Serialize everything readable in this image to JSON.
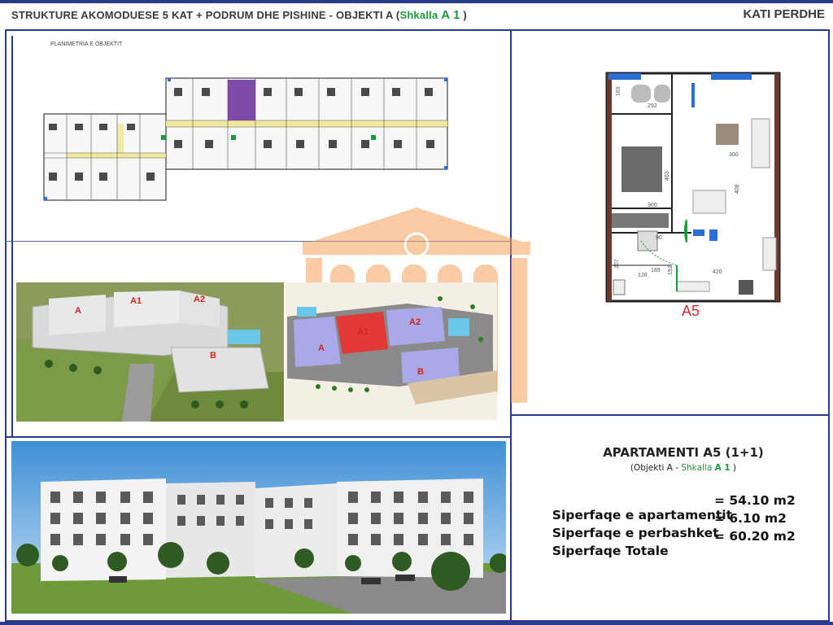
{
  "header": {
    "title_main": "STRUKTURE AKOMODUESE 5 KAT + PODRUM DHE PISHINE   -  OBJEKTI A (",
    "title_stair": "Shkalla",
    "title_stair_id": "A 1",
    "title_close": ")",
    "floor_label": "KATI PERDHE"
  },
  "plan": {
    "label": "PLANIMETRIA E OBJEKTIT"
  },
  "site_labels": {
    "aerial": [
      "A",
      "A1",
      "A2",
      "B"
    ],
    "siteplan": [
      "A",
      "A1",
      "A2",
      "B"
    ]
  },
  "unit_plan": {
    "unit_name": "A5",
    "dimensions": [
      "292",
      "163",
      "300",
      "403",
      "408",
      "300",
      "420",
      "207",
      "192",
      "189",
      "90",
      "128"
    ]
  },
  "apartment": {
    "title": "APARTAMENTI A5 (1+1)",
    "sub_open": "(Objekti A - ",
    "sub_stair": "Shkalla",
    "sub_stair_id": "A 1",
    "sub_close": " )",
    "rows": [
      {
        "label": "Siperfaqe e apartamentit",
        "value": "= 54.10 m2"
      },
      {
        "label": "Siperfaqe e perbashket",
        "value": "=  6.10 m2"
      },
      {
        "label": "Siperfaqe Totale",
        "value": "= 60.20 m2"
      }
    ]
  },
  "colors": {
    "frame": "#2a3a8c",
    "accent_green": "#1a9a3a",
    "watermark": "#f4a25a",
    "unit_red": "#cc2a2a"
  }
}
